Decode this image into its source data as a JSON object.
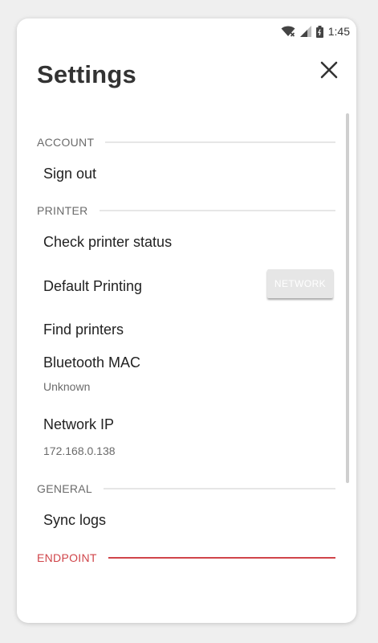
{
  "status_bar": {
    "time": "1:45",
    "icons": [
      "wifi-icon",
      "signal-icon",
      "battery-icon"
    ]
  },
  "header": {
    "title": "Settings",
    "close_icon": "close-icon"
  },
  "sections": {
    "account": {
      "label": "ACCOUNT",
      "items": {
        "sign_out": "Sign out"
      }
    },
    "printer": {
      "label": "PRINTER",
      "items": {
        "check_status": "Check printer status",
        "default_printing": "Default Printing",
        "default_printing_value": "NETWORK",
        "find_printers": "Find printers",
        "bluetooth_mac": "Bluetooth MAC",
        "bluetooth_mac_value": "Unknown",
        "network_ip": "Network IP",
        "network_ip_value": "172.168.0.138"
      }
    },
    "general": {
      "label": "GENERAL",
      "items": {
        "sync_logs": "Sync logs"
      }
    },
    "endpoint": {
      "label": "ENDPOINT"
    }
  },
  "colors": {
    "accent_red": "#d0454a",
    "section_text": "#6b6b6b",
    "button_bg": "#e6e6e6"
  }
}
